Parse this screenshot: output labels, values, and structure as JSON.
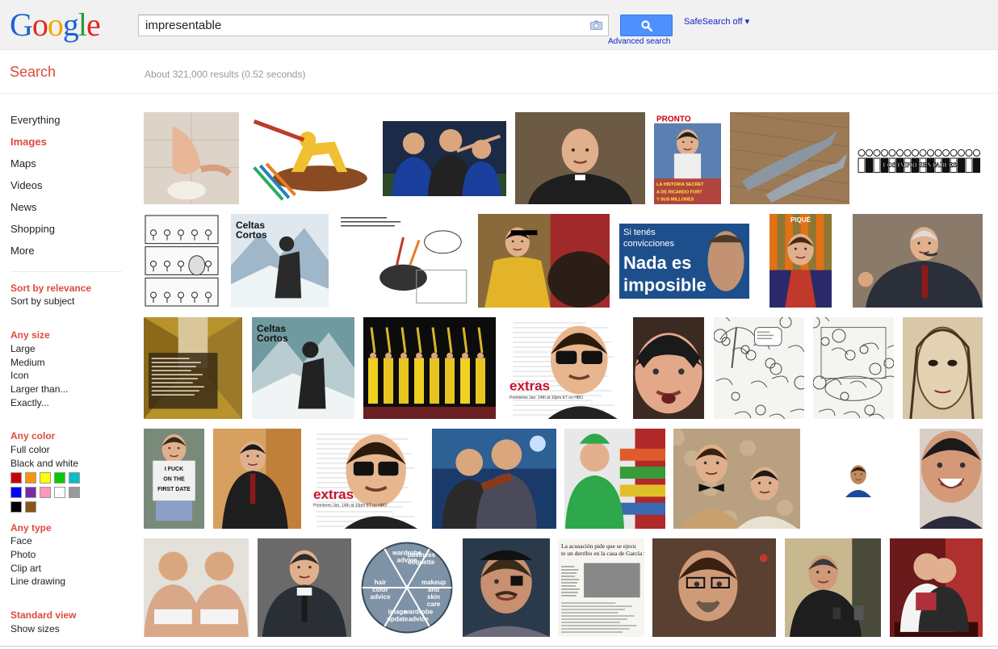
{
  "header": {
    "logo_letters": [
      "G",
      "o",
      "o",
      "g",
      "l",
      "e"
    ],
    "logo_colors": [
      "#1a63d6",
      "#dd2b1f",
      "#f2a900",
      "#1a63d6",
      "#2a9a3c",
      "#dd2b1f"
    ],
    "search_query": "impresentable",
    "advanced_search": "Advanced search",
    "safesearch": "SafeSearch off ▾"
  },
  "search_heading": "Search",
  "result_stats": "About 321,000 results (0.52 seconds)",
  "sidebar": {
    "nav": [
      "Everything",
      "Images",
      "Maps",
      "Videos",
      "News",
      "Shopping",
      "More"
    ],
    "active_nav": "Images",
    "sort": {
      "active": "Sort by relevance",
      "other": "Sort by subject"
    },
    "size": {
      "active": "Any size",
      "items": [
        "Large",
        "Medium",
        "Icon",
        "Larger than...",
        "Exactly..."
      ]
    },
    "color": {
      "active": "Any color",
      "items": [
        "Full color",
        "Black and white"
      ],
      "swatches": [
        "#cc0000",
        "#fb940b",
        "#ffff00",
        "#00cc00",
        "#03c0c6",
        "#0000ff",
        "#762ca7",
        "#ff98bf",
        "#ffffff",
        "#999999",
        "#000000",
        "#885418"
      ]
    },
    "type": {
      "active": "Any type",
      "items": [
        "Face",
        "Photo",
        "Clip art",
        "Line drawing"
      ]
    },
    "view": {
      "active": "Standard view",
      "items": [
        "Show sizes"
      ]
    }
  },
  "images": [
    {
      "name": "nose-sculpture"
    },
    {
      "name": "yellow-figure-pencils"
    },
    {
      "name": "football-referee"
    },
    {
      "name": "bishop-portrait"
    },
    {
      "name": "pronto-magazine-cover"
    },
    {
      "name": "fish-on-floor"
    },
    {
      "name": "crowd-sketch"
    },
    {
      "name": "comic-strip"
    },
    {
      "name": "celtas-cortos-cover"
    },
    {
      "name": "bull-cartoon"
    },
    {
      "name": "bullfighter"
    },
    {
      "name": "nada-es-imposible-poster"
    },
    {
      "name": "pique-caricature"
    },
    {
      "name": "politician-gesturing"
    },
    {
      "name": "hotel-corridor-text"
    },
    {
      "name": "celtas-cortos-cover-2"
    },
    {
      "name": "costumed-parade"
    },
    {
      "name": "extras-sunglasses-man"
    },
    {
      "name": "woman-face-closeup"
    },
    {
      "name": "island-cartoon"
    },
    {
      "name": "room-cartoon"
    },
    {
      "name": "face-sketch"
    },
    {
      "name": "boy-tshirt"
    },
    {
      "name": "man-in-suit-armchair"
    },
    {
      "name": "extras-poster"
    },
    {
      "name": "concert-guitarist"
    },
    {
      "name": "green-costume-store"
    },
    {
      "name": "couple-costume"
    },
    {
      "name": "small-player-photo"
    },
    {
      "name": "laughing-man"
    },
    {
      "name": "underwear-models"
    },
    {
      "name": "coach-jacket"
    },
    {
      "name": "wardrobe-pie-chart"
    },
    {
      "name": "pirate-man"
    },
    {
      "name": "newspaper-clipping"
    },
    {
      "name": "bearded-man-glasses"
    },
    {
      "name": "speaker-microphones"
    },
    {
      "name": "red-room-couple"
    }
  ],
  "pie_labels": [
    "business etiquette",
    "makeup and skin care",
    "wardrobe advice",
    "image update",
    "hair color advice",
    "wardrobe advice"
  ],
  "extras_text": {
    "brand": "extras",
    "premiere": "Premieres Jan. 14th at 10pm ET on HBO"
  },
  "poster_text": {
    "line1": "Si tenés",
    "line2": "convicciones",
    "line3": "Nada es",
    "line4": "imposible"
  },
  "magazine_text": {
    "title": "PRONTO",
    "headline": "LA HISTORIA SECRETA DE RICARDO FORT Y SUS MILLONES"
  },
  "album_text": {
    "title": "Celtas Cortos"
  },
  "shirt_text": "I FUCK ON THE FIRST DATE",
  "newspaper_text": "La acusación pide que se ejecute un derribo en la casa de García Seoane",
  "caricature_text": "PIQUÉ",
  "tarot_text": "LOS IMPRESENTABLES"
}
